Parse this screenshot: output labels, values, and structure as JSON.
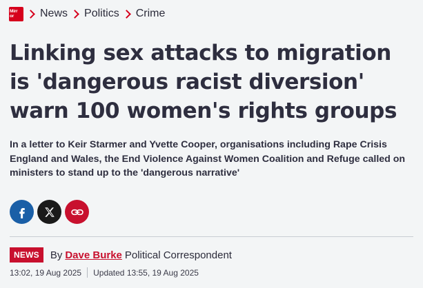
{
  "brand": {
    "logo_line1": "Mirr",
    "logo_line2": "or",
    "accent": "#d6001c"
  },
  "breadcrumb": {
    "items": [
      "News",
      "Politics",
      "Crime"
    ]
  },
  "headline": "Linking sex attacks to migration is 'dangerous racist diversion' warn 100 women's rights groups",
  "standfirst": "In a letter to Keir Starmer and Yvette Cooper, organisations including Rape Crisis England and Wales, the End Violence Against Women Coalition and Refuge called on ministers to stand up to the 'dangerous narrative'",
  "share": {
    "icons": [
      "facebook-icon",
      "x-icon",
      "link-icon"
    ]
  },
  "byline": {
    "tag": "NEWS",
    "by": "By",
    "author": "Dave Burke",
    "role": "Political Correspondent"
  },
  "dates": {
    "published": "13:02, 19 Aug 2025",
    "updated": "Updated 13:55, 19 Aug 2025"
  }
}
